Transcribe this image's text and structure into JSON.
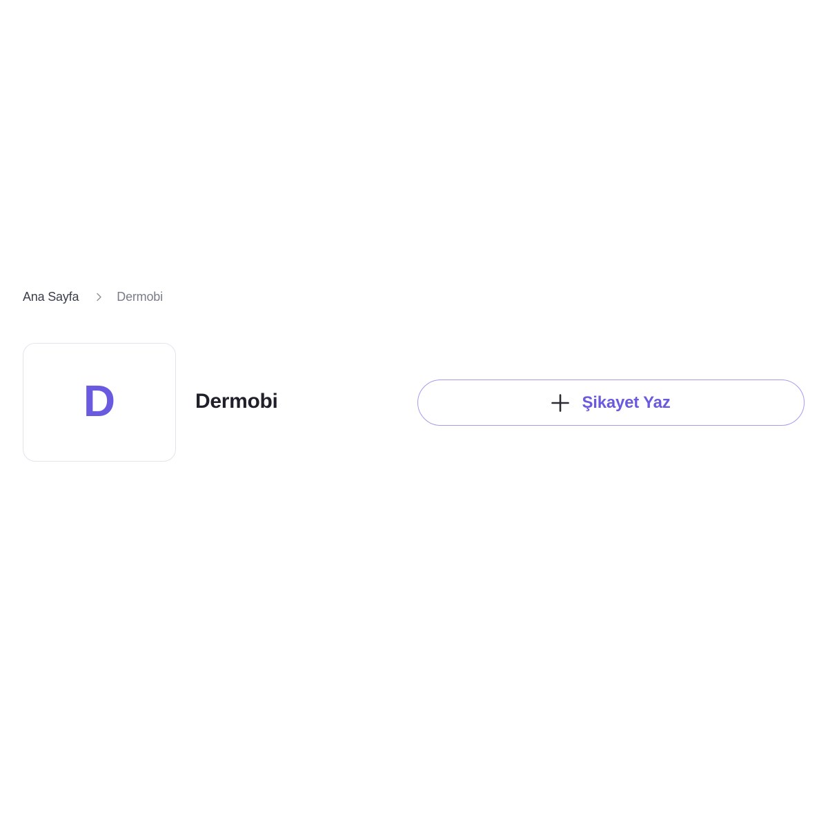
{
  "breadcrumb": {
    "home_label": "Ana Sayfa",
    "current_label": "Dermobi"
  },
  "company": {
    "logo_letter": "D",
    "name": "Dermobi"
  },
  "actions": {
    "write_complaint_label": "Şikayet Yaz"
  },
  "icons": {
    "separator": "chevron-right-icon",
    "add": "plus-icon"
  },
  "colors": {
    "accent": "#6a5ae0",
    "button_border": "#a49bf0",
    "text_primary": "#1f2029",
    "text_muted": "#7a7c88",
    "logo_border": "#e3e4ea"
  }
}
